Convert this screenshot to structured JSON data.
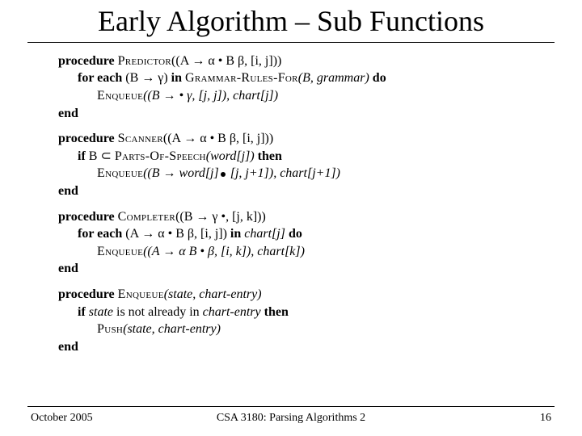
{
  "title": "Early Algorithm – Sub Functions",
  "proc": {
    "predictor": {
      "kw": "procedure",
      "name": "Predictor",
      "sig": "((A → α • B β, [i, j]))"
    },
    "scanner": {
      "kw": "procedure",
      "name": "Scanner",
      "sig": "((A → α • B β, [i, j]))"
    },
    "completer": {
      "kw": "procedure",
      "name": "Completer",
      "sig": "((B → γ •, [j, k]))"
    },
    "enqueue": {
      "kw": "procedure",
      "name": "Enqueue",
      "sig": "(state, chart-entry)"
    }
  },
  "lines": {
    "p1a": "for each ",
    "p1b": "(B → γ) ",
    "p1c": "in ",
    "p1d": "Grammar-Rules-For",
    "p1e": "(B, grammar) ",
    "p1f": "do",
    "p2a": "Enqueue",
    "p2b": "((B → • γ, [j, j]), chart[j])",
    "end": "end",
    "s1a": "if ",
    "s1b": "B ⊂ ",
    "s1c": "Parts-Of-Speech",
    "s1d": "(word[j]) ",
    "s1e": "then",
    "s2a": "Enqueue",
    "s2b": "((B → word[j]",
    "s2c": " [j, j+1]), chart[j+1])",
    "c1a": "for each ",
    "c1b": "(A → α • B β, [i, j]) ",
    "c1c": "in ",
    "c1d": "chart[j] ",
    "c1e": "do",
    "c2a": "Enqueue",
    "c2b": "((A → α B • β, [i, k]), chart[k])",
    "e1a": "if ",
    "e1b": "state ",
    "e1c": "is not already in ",
    "e1d": "chart-entry ",
    "e1e": "then",
    "e2a": "Push",
    "e2b": "(state, chart-entry)"
  },
  "footer": {
    "left": "October 2005",
    "center": "CSA 3180: Parsing Algorithms 2",
    "right": "16"
  }
}
